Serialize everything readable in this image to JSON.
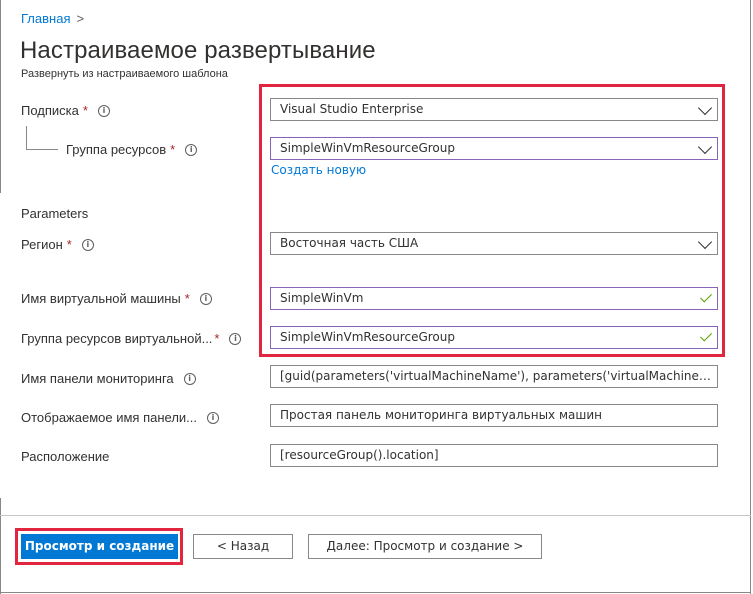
{
  "breadcrumb": {
    "home": "Главная",
    "separator": ">"
  },
  "header": {
    "title": "Настраиваемое развертывание",
    "subtitle": "Развернуть из настраиваемого шаблона"
  },
  "form": {
    "subscription": {
      "label": "Подписка",
      "required": "*",
      "info": "i",
      "value": "Visual Studio Enterprise"
    },
    "resource_group": {
      "label": "Группа ресурсов",
      "required": "*",
      "info": "i",
      "value": "SimpleWinVmResourceGroup",
      "create_new": "Создать новую"
    },
    "parameters_heading": "Parameters",
    "region": {
      "label": "Регион",
      "required": "*",
      "info": "i",
      "value": "Восточная часть США"
    },
    "vm_name": {
      "label": "Имя виртуальной машины",
      "required": "*",
      "info": "i",
      "value": "SimpleWinVm"
    },
    "vm_resource_group": {
      "label": "Группа ресурсов виртуальной...",
      "required": "*",
      "info": "i",
      "value": "SimpleWinVmResourceGroup"
    },
    "dashboard_name": {
      "label": "Имя панели мониторинга",
      "info": "i",
      "value": "[guid(parameters('virtualMachineName'), parameters('virtualMachineReso..."
    },
    "dashboard_display_name": {
      "label": "Отображаемое имя панели...",
      "info": "i",
      "value": "Простая панель мониторинга виртуальных машин"
    },
    "location": {
      "label": "Расположение",
      "value": "[resourceGroup().location]"
    }
  },
  "footer": {
    "review_create": "Просмотр и создание",
    "back": "< Назад",
    "next": "Далее: Просмотр и создание >"
  },
  "colors": {
    "accent": "#0078d4",
    "required": "#a4262c",
    "highlight": "#e3263f",
    "valid": "#57a300",
    "focus_border": "#8764b8"
  }
}
